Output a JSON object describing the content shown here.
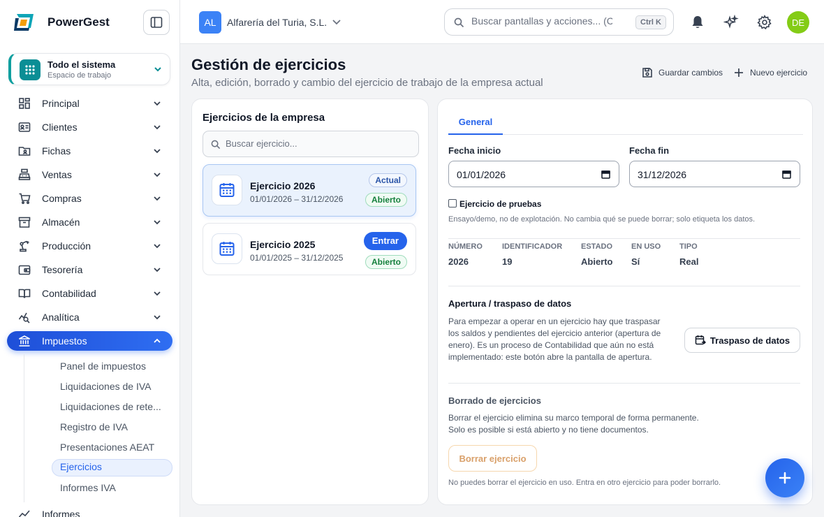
{
  "app": {
    "name": "PowerGest",
    "colors": {
      "accent": "#2563eb",
      "teal": "#0b8e95",
      "avatar": "#84cc16"
    }
  },
  "workspace": {
    "title": "Todo el sistema",
    "subtitle": "Espacio de trabajo"
  },
  "nav": {
    "items": [
      {
        "label": "Principal",
        "icon": "grid-icon"
      },
      {
        "label": "Clientes",
        "icon": "id-card-icon"
      },
      {
        "label": "Fichas",
        "icon": "folder-user-icon"
      },
      {
        "label": "Ventas",
        "icon": "cash-register-icon"
      },
      {
        "label": "Compras",
        "icon": "cart-icon"
      },
      {
        "label": "Almacén",
        "icon": "archive-icon"
      },
      {
        "label": "Producción",
        "icon": "robot-arm-icon"
      },
      {
        "label": "Tesorería",
        "icon": "wallet-icon"
      },
      {
        "label": "Contabilidad",
        "icon": "book-icon"
      },
      {
        "label": "Analítica",
        "icon": "chart-search-icon"
      },
      {
        "label": "Impuestos",
        "icon": "bank-icon"
      }
    ],
    "impuestos_sub": [
      "Panel de impuestos",
      "Liquidaciones de IVA",
      "Liquidaciones de rete...",
      "Registro de IVA",
      "Presentaciones AEAT",
      "Ejercicios",
      "Informes IVA"
    ],
    "next_item": "Informes"
  },
  "topbar": {
    "company_initials": "AL",
    "company_name": "Alfarería del Turia, S.L.",
    "search_placeholder": "Buscar pantallas y acciones... (Ctrl+K)",
    "search_shortcut": "Ctrl K",
    "user_initials": "DE"
  },
  "page": {
    "title": "Gestión de ejercicios",
    "subtitle": "Alta, edición, borrado y cambio del ejercicio de trabajo de la empresa actual",
    "save_label": "Guardar cambios",
    "new_label": "Nuevo ejercicio"
  },
  "list": {
    "title": "Ejercicios de la empresa",
    "search_placeholder": "Buscar ejercicio...",
    "items": [
      {
        "name": "Ejercicio 2026",
        "dates": "01/01/2026 – 31/12/2026",
        "badge": "Actual",
        "status": "Abierto"
      },
      {
        "name": "Ejercicio 2025",
        "dates": "01/01/2025 – 31/12/2025",
        "action": "Entrar",
        "status": "Abierto"
      }
    ]
  },
  "detail": {
    "tab": "General",
    "start_label": "Fecha inicio",
    "start_value": "01/01/2026",
    "end_label": "Fecha fin",
    "end_value": "31/12/2026",
    "test_label": "Ejercicio de pruebas",
    "test_hint": "Ensayo/demo, no de explotación. No cambia qué se puede borrar; solo etiqueta los datos.",
    "meta_headers": [
      "NÚMERO",
      "IDENTIFICADOR",
      "ESTADO",
      "EN USO",
      "TIPO"
    ],
    "meta_values": [
      "2026",
      "19",
      "Abierto",
      "Sí",
      "Real"
    ],
    "apertura_title": "Apertura / traspaso de datos",
    "apertura_lines": [
      "Para empezar a operar en un ejercicio hay que traspasar",
      "los saldos y pendientes del ejercicio anterior (apertura de",
      "enero). Es un proceso de Contabilidad que aún no está",
      "implementado: este botón abre la pantalla de apertura."
    ],
    "traspaso_label": "Traspaso de datos",
    "borrado_title": "Borrado de ejercicios",
    "borrado_lines": [
      "Borrar el ejercicio elimina su marco temporal de forma permanente.",
      "Solo es posible si está abierto y no tiene documentos."
    ],
    "borrar_label": "Borrar ejercicio",
    "borrar_hint": "No puedes borrar el ejercicio en uso. Entra en otro ejercicio para poder borrarlo."
  }
}
